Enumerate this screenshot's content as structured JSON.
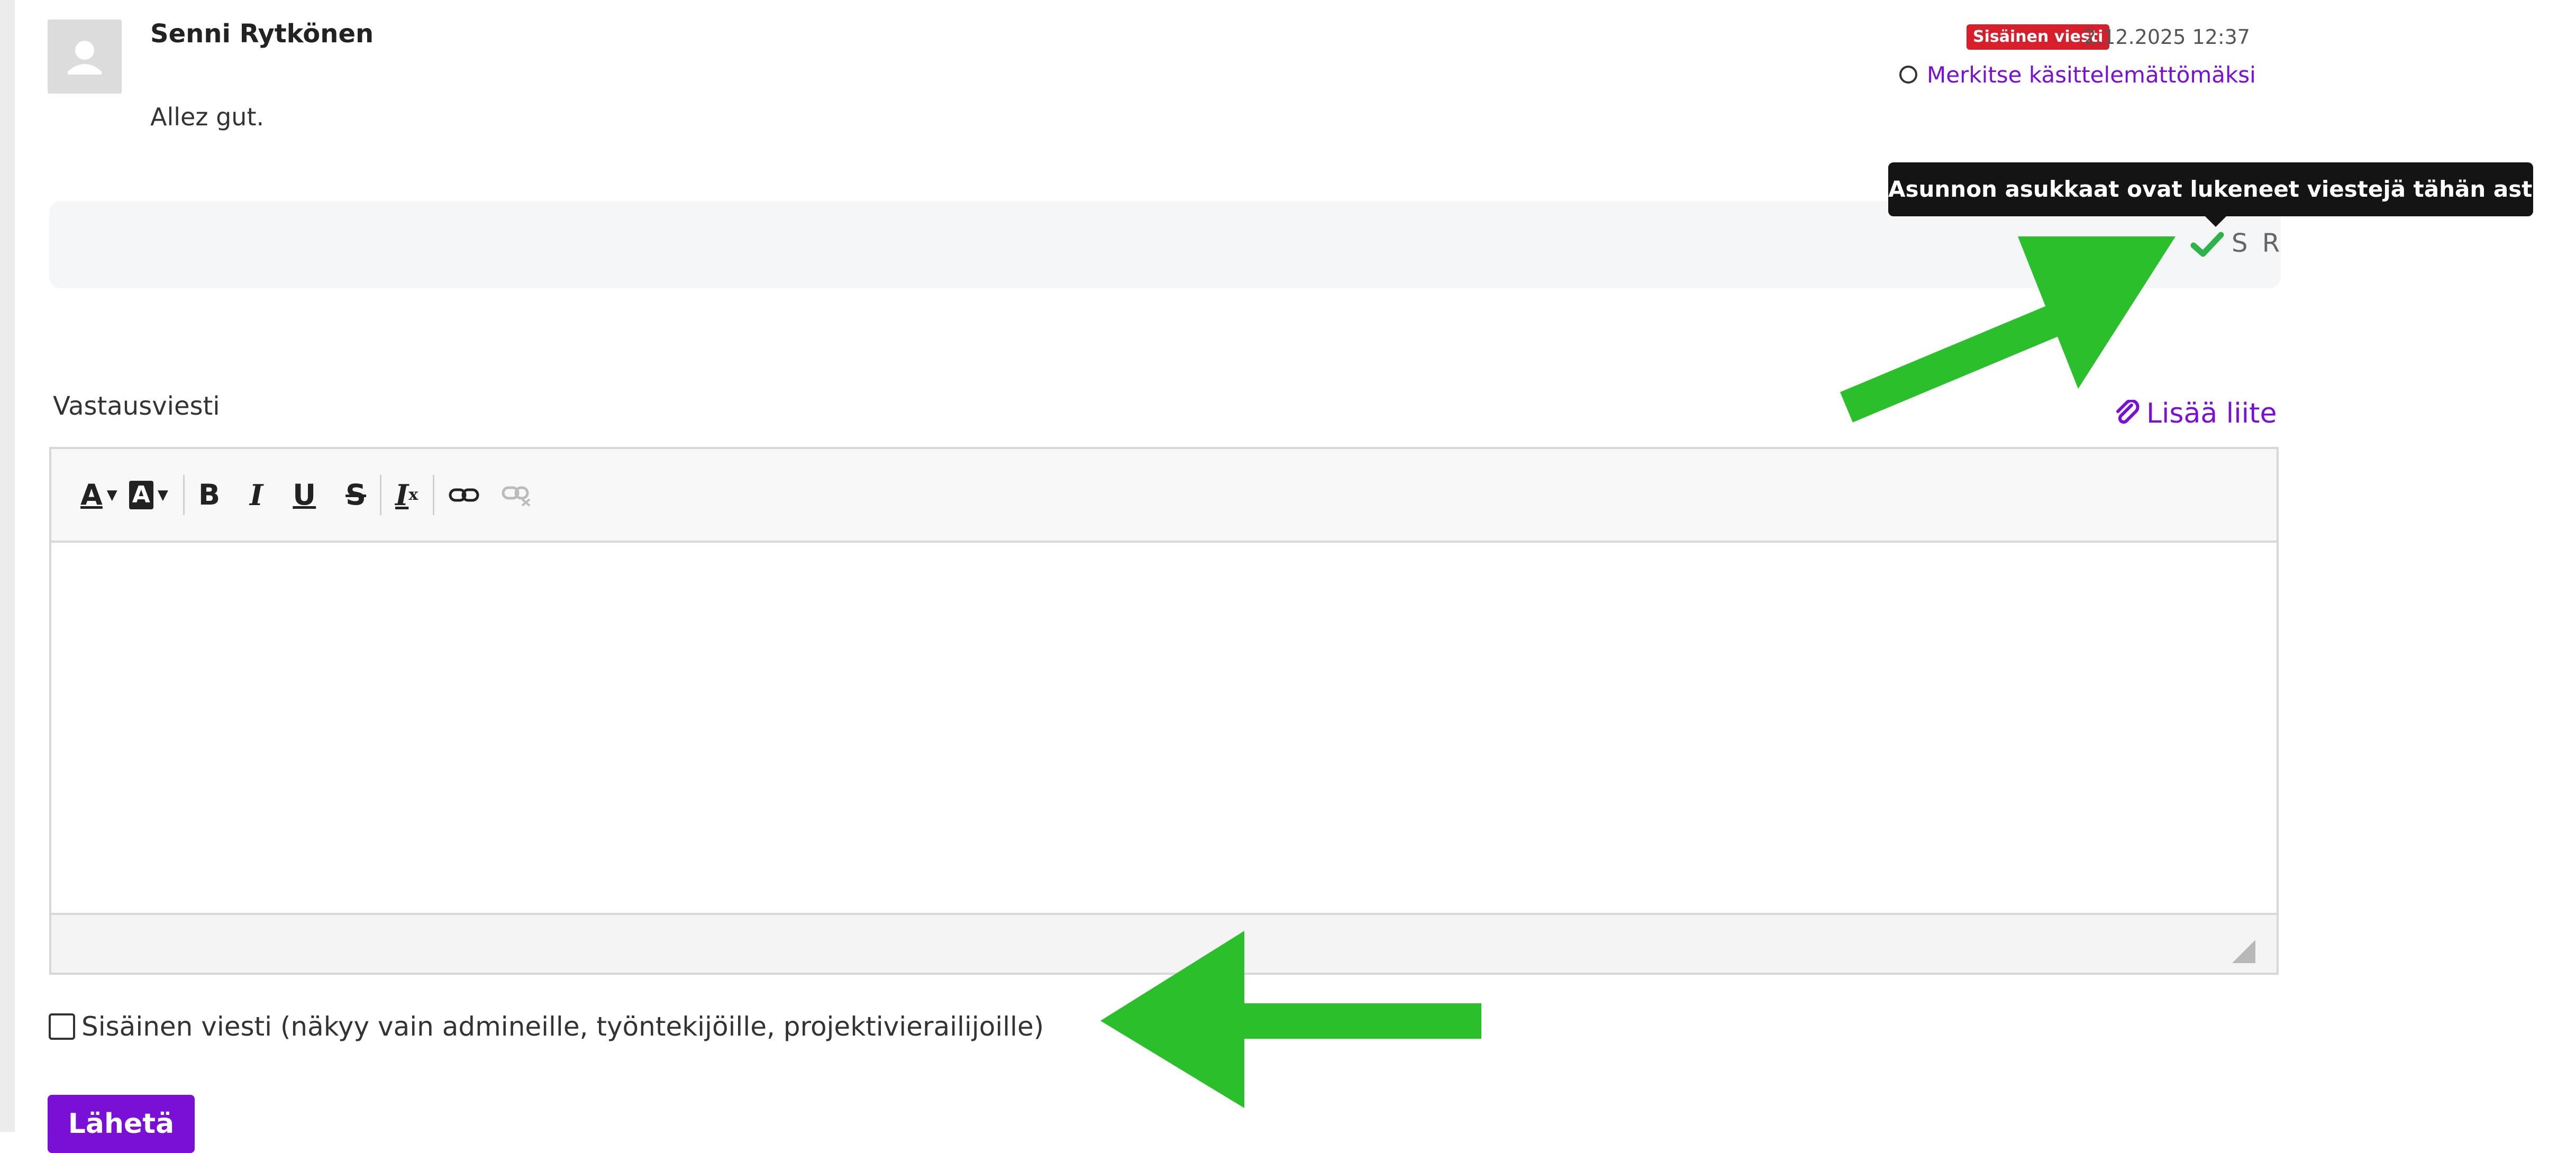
{
  "message": {
    "author": "Senni Rytkönen",
    "text": "Allez gut.",
    "badge": "Sisäinen viesti",
    "timestamp": "2.12.2025 12:37",
    "mark_unread_label": "Merkitse käsittelemättömäksi",
    "read_initials": "S R",
    "read_tooltip": "Asunnon asukkaat ovat lukeneet viestejä tähän asti."
  },
  "reply": {
    "label": "Vastausviesti",
    "attach_label": "Lisää liite",
    "toolbar": [
      {
        "name": "text-color-button",
        "glyph": "A"
      },
      {
        "name": "background-color-button",
        "glyph": "A"
      },
      {
        "name": "bold-button",
        "glyph": "B"
      },
      {
        "name": "italic-button",
        "glyph": "I"
      },
      {
        "name": "underline-button",
        "glyph": "U"
      },
      {
        "name": "strikethrough-button",
        "glyph": "S"
      },
      {
        "name": "remove-format-button",
        "glyph": "I"
      },
      {
        "name": "link-icon"
      },
      {
        "name": "unlink-icon"
      }
    ],
    "internal_checkbox_label": "Sisäinen viesti (näkyy vain admineille, työntekijöille, projektivierailijoille)",
    "send_label": "Lähetä"
  },
  "colors": {
    "accent": "#7a0fd6",
    "badge": "#d71f2c",
    "check": "#2eb34a",
    "arrow": "#2bbf2b"
  }
}
